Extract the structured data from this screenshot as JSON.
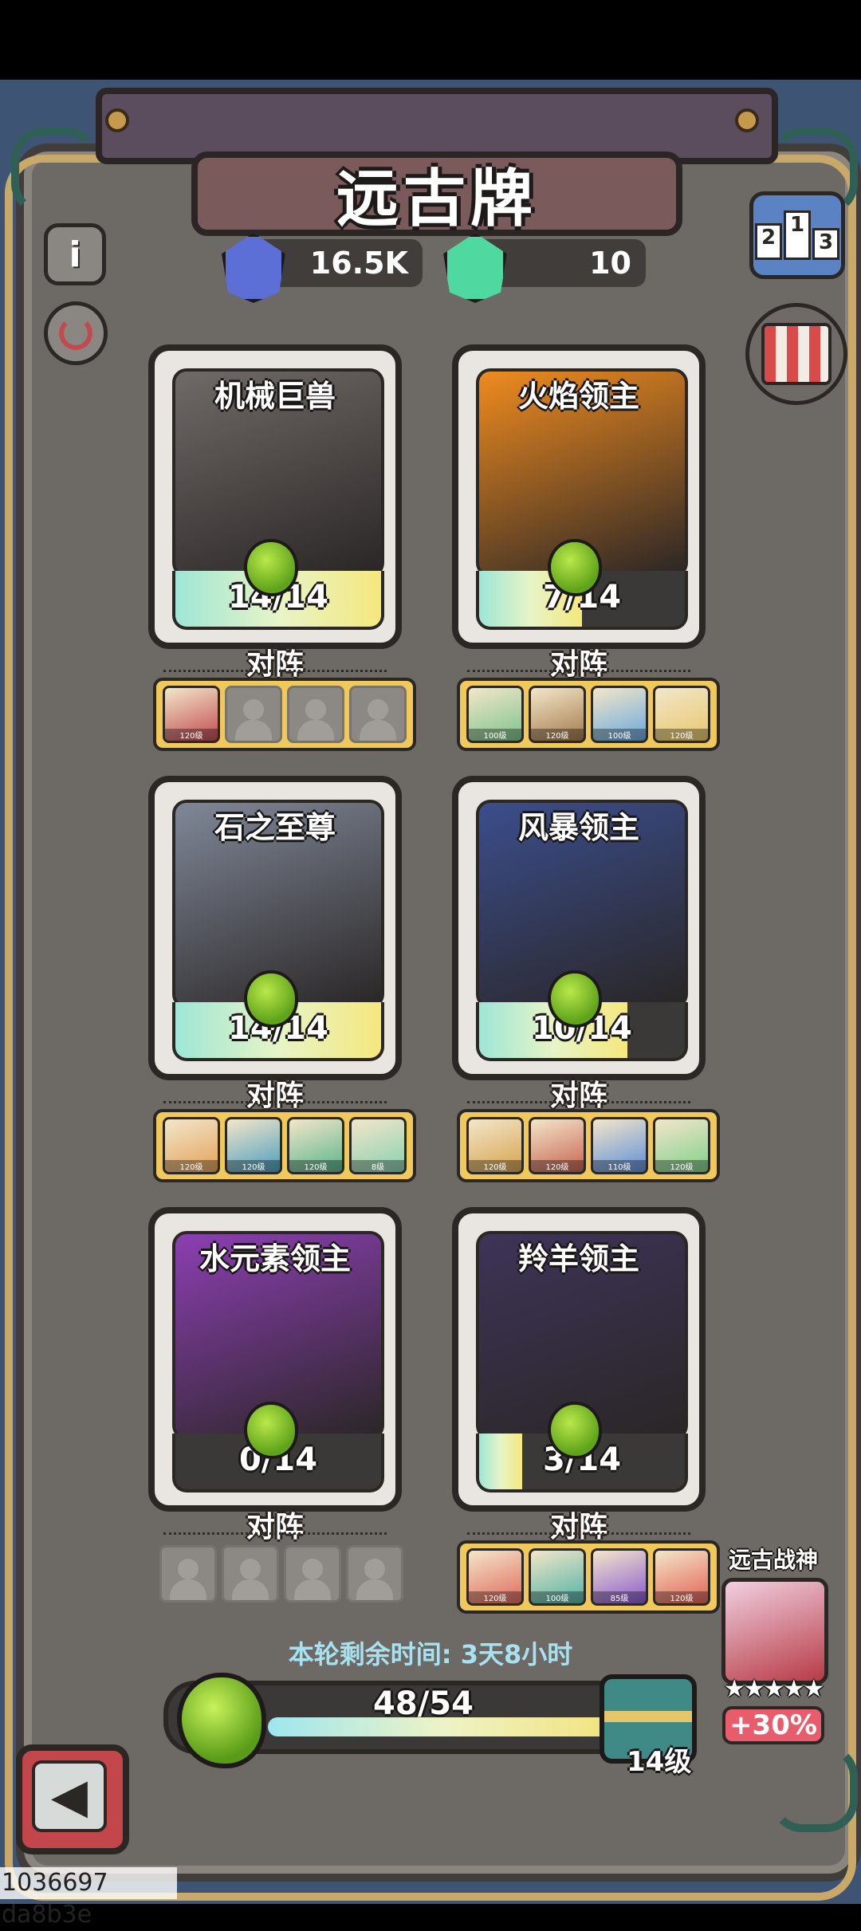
{
  "title": "远古牌",
  "currencies": [
    {
      "icon": "blue-gem-icon",
      "value": "16.5K",
      "color": "#5c6fd6"
    },
    {
      "icon": "green-gem-icon",
      "value": "10",
      "color": "#4fd9a0"
    }
  ],
  "side_buttons": {
    "info": "info-icon",
    "refresh": "refresh-icon",
    "ranking": "ranking-podium-icon",
    "shop": "shop-icon"
  },
  "ranking_digits": [
    "2",
    "1",
    "3"
  ],
  "cards": [
    {
      "name": "机械巨兽",
      "count": "14/14",
      "progress": 1.0,
      "art": "#6f6a66",
      "vs_label": "对阵",
      "heroes": [
        {
          "level": "120级",
          "color": "#c24a4f"
        },
        {
          "empty": true
        },
        {
          "empty": true
        },
        {
          "empty": true
        }
      ]
    },
    {
      "name": "火焰领主",
      "count": "7/14",
      "progress": 0.5,
      "art": "#ef8b1f",
      "vs_label": "对阵",
      "heroes": [
        {
          "level": "100级",
          "color": "#7cc48b"
        },
        {
          "level": "120级",
          "color": "#a47a4a"
        },
        {
          "level": "100级",
          "color": "#69a9de"
        },
        {
          "level": "120级",
          "color": "#e7c76d"
        }
      ]
    },
    {
      "name": "石之至尊",
      "count": "14/14",
      "progress": 1.0,
      "art": "#7f8797",
      "vs_label": "对阵",
      "heroes": [
        {
          "level": "120级",
          "color": "#e3a15b"
        },
        {
          "level": "120级",
          "color": "#4b9ec0"
        },
        {
          "level": "120级",
          "color": "#59b58c"
        },
        {
          "level": "8级",
          "color": "#87d1b0"
        }
      ]
    },
    {
      "name": "风暴领主",
      "count": "10/14",
      "progress": 0.72,
      "art": "#3b4e8c",
      "vs_label": "对阵",
      "heroes": [
        {
          "level": "120级",
          "color": "#d6a34f"
        },
        {
          "level": "120级",
          "color": "#c86350"
        },
        {
          "level": "110级",
          "color": "#5d8fd9"
        },
        {
          "level": "120级",
          "color": "#7fd08a"
        }
      ]
    },
    {
      "name": "水元素领主",
      "count": "0/14",
      "progress": 0.0,
      "art": "#8c3fb2",
      "vs_label": "对阵",
      "heroes": [
        {
          "empty": true
        },
        {
          "empty": true
        },
        {
          "empty": true
        },
        {
          "empty": true
        }
      ]
    },
    {
      "name": "羚羊领主",
      "count": "3/14",
      "progress": 0.21,
      "art": "#3e3458",
      "vs_label": "对阵",
      "heroes": [
        {
          "level": "120级",
          "color": "#e06a5c"
        },
        {
          "level": "100级",
          "color": "#4fb3a5"
        },
        {
          "level": "85级",
          "color": "#8a5ad1"
        },
        {
          "level": "120级",
          "color": "#e36254"
        }
      ]
    }
  ],
  "timer": {
    "label": "本轮剩余时间:",
    "value": "3天8小时"
  },
  "main_progress": {
    "text": "48/54",
    "fraction": 0.889,
    "level": "14级"
  },
  "ancient_god": {
    "name": "远古战神",
    "stars": "★★★★★",
    "bonus": "+30%"
  },
  "watermark": "1036697 da8b3e"
}
